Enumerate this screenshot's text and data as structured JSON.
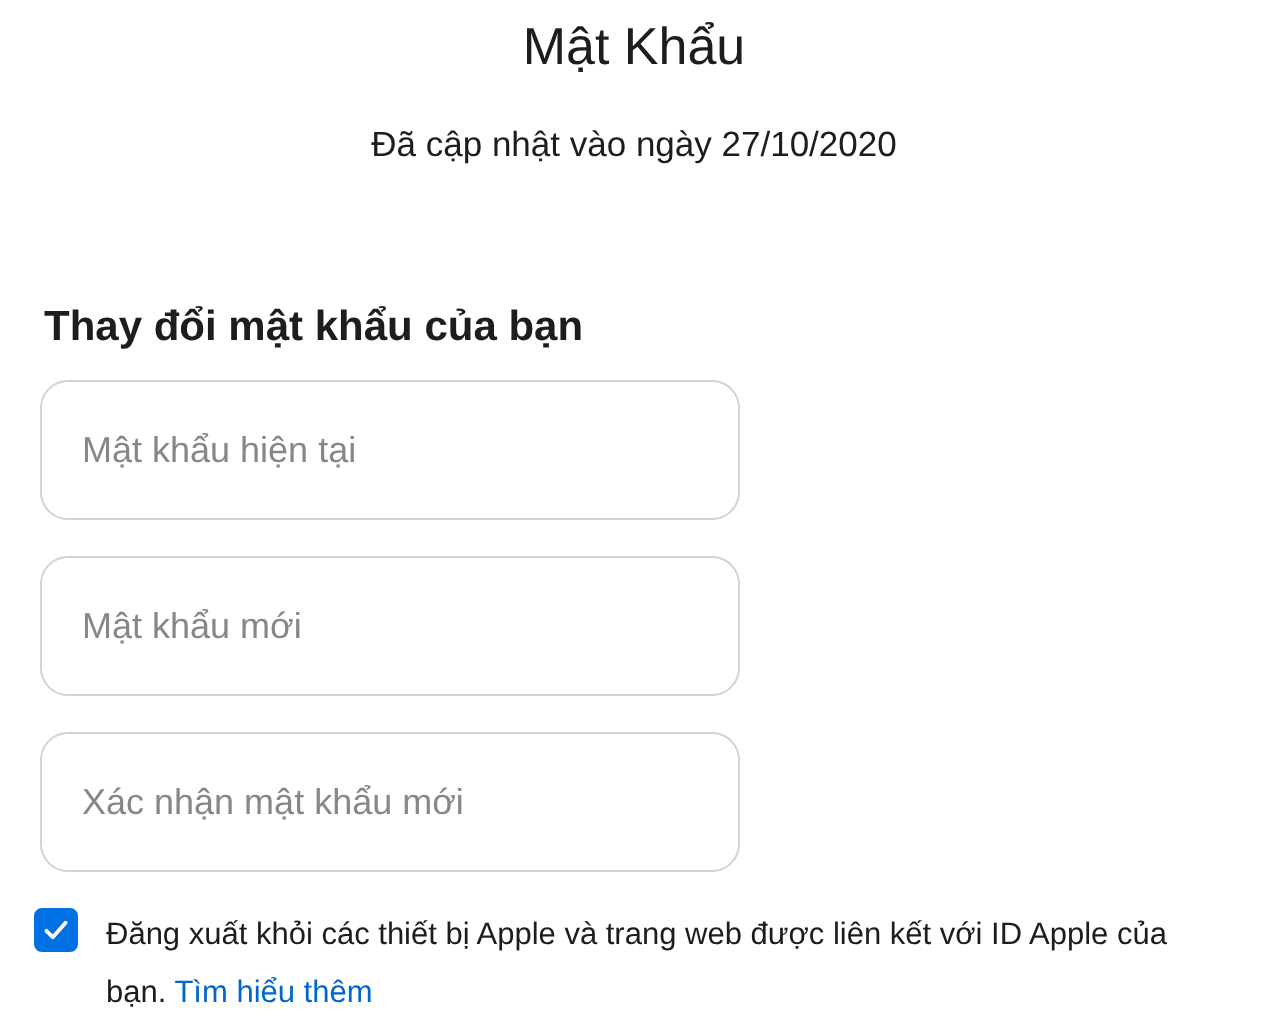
{
  "title": "Mật Khẩu",
  "updated": "Đã cập nhật vào ngày 27/10/2020",
  "heading": "Thay đổi mật khẩu của bạn",
  "fields": [
    {
      "placeholder": "Mật khẩu hiện tại"
    },
    {
      "placeholder": "Mật khẩu mới"
    },
    {
      "placeholder": "Xác nhận mật khẩu mới"
    }
  ],
  "sign_out": {
    "checked": true,
    "text": "Đăng xuất khỏi các thiết bị Apple và trang web được liên kết với ID Apple của bạn.",
    "link": "Tìm hiểu thêm"
  }
}
